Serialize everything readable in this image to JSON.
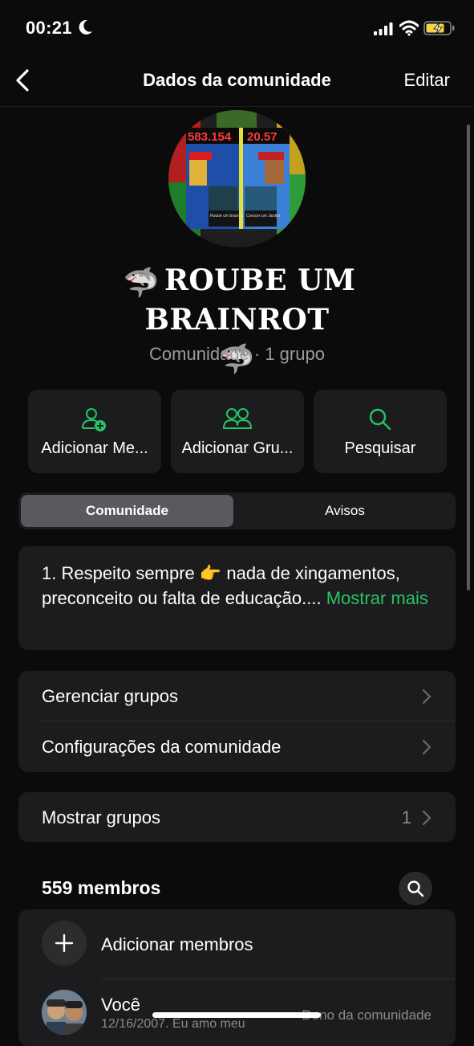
{
  "status": {
    "time": "00:21"
  },
  "nav": {
    "title": "Dados da comunidade",
    "edit": "Editar"
  },
  "community": {
    "name": "ROUBE UM BRAINROT",
    "emoji": "🦈",
    "subtitle": "Comunidade · 1 grupo",
    "avatar_texts": {
      "left_score": "583.154",
      "right_score": "20.57",
      "left_caption": "Roube um brainrot",
      "right_caption": "Crescer um Jardim"
    }
  },
  "actions": [
    {
      "label": "Adicionar Me...",
      "icon": "add-person-icon"
    },
    {
      "label": "Adicionar Gru...",
      "icon": "group-icon"
    },
    {
      "label": "Pesquisar",
      "icon": "search-icon"
    }
  ],
  "tabs": {
    "active": "Comunidade",
    "other": "Avisos"
  },
  "description": {
    "text": "1. Respeito sempre 👉 nada de xingamentos, preconceito ou falta de educação....",
    "more": "Mostrar mais"
  },
  "settings": [
    {
      "label": "Gerenciar grupos"
    },
    {
      "label": "Configurações da comunidade"
    }
  ],
  "groups_row": {
    "label": "Mostrar grupos",
    "count": "1"
  },
  "members": {
    "title": "559 membros",
    "add_label": "Adicionar membros",
    "list": [
      {
        "name": "Você",
        "about": "12/16/2007. Eu amo meu",
        "role": "Dono da comunidade"
      }
    ]
  },
  "colors": {
    "accent": "#25c464",
    "background": "#0b0b0b",
    "card": "#1c1c1e"
  }
}
